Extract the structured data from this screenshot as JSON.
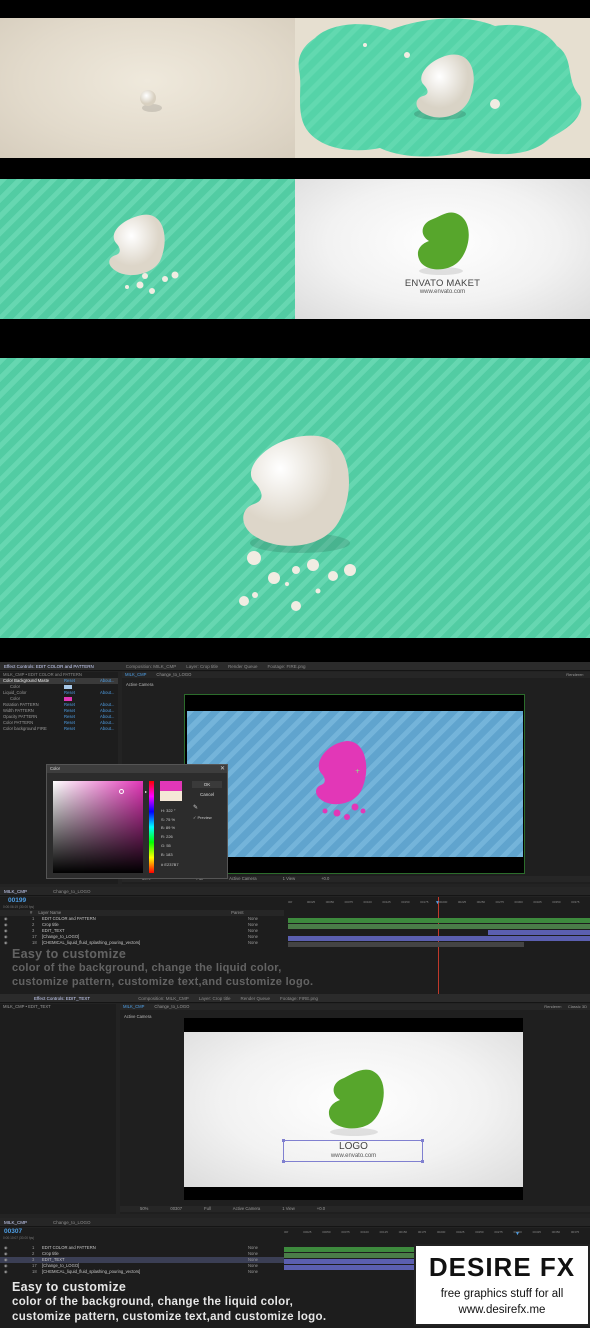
{
  "logo_preview": {
    "brand_name": "ENVATO MAKET",
    "brand_url": "www.envato.com"
  },
  "ae_panel_1": {
    "top_tabs": [
      "Effect Controls: EDIT COLOR and PATTERN",
      "Composition: MILK_CMP",
      "Layer: Crop title",
      "Render Queue",
      "Footage: FIRE.png"
    ],
    "comp_tabs": [
      "MILK_CMP",
      "Change_to_LOGO"
    ],
    "breadcrumb": "MILK_CMP • EDIT COLOR and PATTERN",
    "effects": [
      {
        "name": "Color Background Maste",
        "reset": "Reset",
        "about": "About..."
      },
      {
        "name": "Color",
        "reset": "",
        "about": ""
      },
      {
        "name": "Liquid_Color",
        "reset": "Reset",
        "about": "About..."
      },
      {
        "name": "Color",
        "reset": "",
        "about": ""
      },
      {
        "name": "Rotation PATTERN",
        "reset": "Reset",
        "about": "About..."
      },
      {
        "name": "Width PATTERN",
        "reset": "Reset",
        "about": "About..."
      },
      {
        "name": "Opacity PATTERN",
        "reset": "Reset",
        "about": "About..."
      },
      {
        "name": "Color PATTERN",
        "reset": "Reset",
        "about": "About..."
      },
      {
        "name": "Color background FIRE",
        "reset": "Reset",
        "about": "About..."
      }
    ],
    "viewer_label": "Active Camera",
    "renderer": "Renderer:",
    "color_dialog": {
      "title": "Color",
      "ok": "OK",
      "cancel": "Cancel",
      "preview": "Preview",
      "fields": [
        "H: 322 °",
        "S: 75 %",
        "B: 89 %",
        "R: 226",
        "G: 55",
        "B: 183"
      ],
      "hex": "# E237B7"
    },
    "viewer_footer": [
      "50%",
      "Full",
      "Active Camera",
      "1 View",
      "+0.0"
    ],
    "timeline_tabs": [
      "MILK_CMP",
      "Change_to_LOGO"
    ],
    "timecode": "00199",
    "timecode_sub": "0:00:06:19 (30.00 fps)",
    "layer_header": [
      "#",
      "Layer Name",
      "Parent"
    ],
    "layers": [
      {
        "num": "1",
        "name": "EDIT COLOR and PATTERN",
        "parent": "None"
      },
      {
        "num": "2",
        "name": "Crop title",
        "parent": "None"
      },
      {
        "num": "3",
        "name": "EDIT_TEXT",
        "parent": "None"
      },
      {
        "num": "17",
        "name": "[Change_to_LOGO]",
        "parent": "None"
      },
      {
        "num": "18",
        "name": "[CHEMICAL_liquid_fluid_splashing_pouring_vectors]",
        "parent": "None"
      }
    ],
    "ruler": [
      "00f",
      "00025",
      "00050",
      "00075",
      "00100",
      "00125",
      "00150",
      "00175",
      "00200",
      "00225",
      "00250",
      "00275",
      "00300",
      "00325",
      "00350",
      "00375"
    ]
  },
  "captions": {
    "line1": "Easy to customize",
    "line2": "color of the background, change the liquid color,",
    "line3": "customize pattern, customize text,and customize logo."
  },
  "ae_panel_2": {
    "top_tabs": [
      "Effect Controls: EDIT_TEXT",
      "Composition: MILK_CMP",
      "Layer: Crop title",
      "Render Queue",
      "Footage: FIRE.png"
    ],
    "comp_tabs": [
      "MILK_CMP",
      "Change_to_LOGO"
    ],
    "breadcrumb": "MILK_CMP • EDIT_TEXT",
    "viewer_label": "Active Camera",
    "renderer": "Renderer:",
    "renderer_value": "Classic 3D",
    "logo_text": "LOGO",
    "logo_url": "www.envato.com",
    "viewer_footer": [
      "50%",
      "00307",
      "Full",
      "Active Camera",
      "1 View",
      "+0.0"
    ],
    "timeline_tabs": [
      "MILK_CMP",
      "Change_to_LOGO"
    ],
    "timecode": "00307",
    "timecode_sub": "0:00:10:07 (30.00 fps)",
    "layers": [
      {
        "num": "1",
        "name": "EDIT COLOR and PATTERN",
        "parent": "None"
      },
      {
        "num": "2",
        "name": "Crop title",
        "parent": "None"
      },
      {
        "num": "3",
        "name": "EDIT_TEXT",
        "parent": "None"
      },
      {
        "num": "17",
        "name": "[Change_to_LOGO]",
        "parent": "None"
      },
      {
        "num": "18",
        "name": "[CHEMICAL_liquid_fluid_splashing_pouring_vectors]",
        "parent": "None"
      }
    ]
  },
  "watermark": {
    "brand": "DESIRE FX",
    "line1": "free graphics stuff for all",
    "line2": "www.desirefx.me"
  },
  "colors": {
    "teal": "#55d3a8",
    "cream": "#e6dfd0",
    "logo_green": "#57a62c",
    "liquid_pink": "#e237b7",
    "ae_blue": "#64abd6"
  }
}
